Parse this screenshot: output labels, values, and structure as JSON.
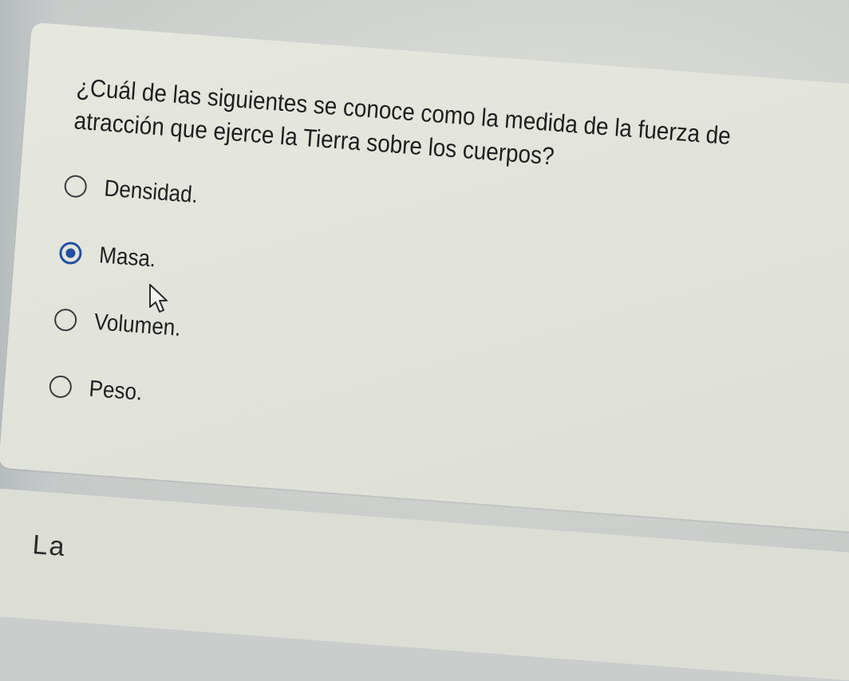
{
  "question": {
    "line1": "¿Cuál de las siguientes se conoce como la medida de la fuerza de",
    "line2": "atracción que ejerce la Tierra sobre los cuerpos?"
  },
  "options": [
    {
      "label": "Densidad.",
      "selected": false
    },
    {
      "label": "Masa.",
      "selected": true
    },
    {
      "label": "Volumen.",
      "selected": false
    },
    {
      "label": "Peso.",
      "selected": false
    }
  ],
  "next_question_partial": "La",
  "colors": {
    "selected_radio": "#244ea0",
    "text": "#1e1e1e",
    "card": "#e4e6de"
  },
  "cursor_icon": "mouse-pointer-icon"
}
